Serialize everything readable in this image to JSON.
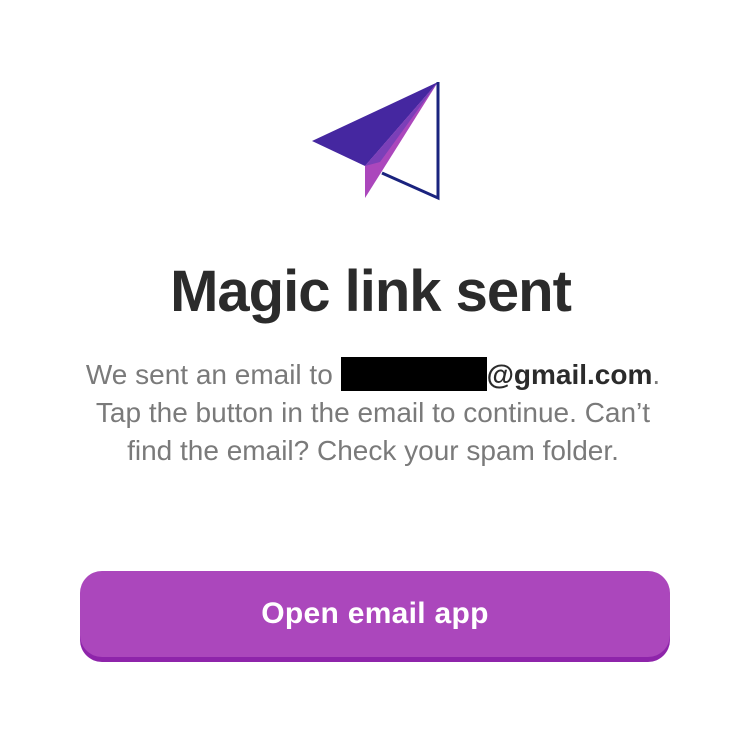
{
  "icon": "paper-plane-icon",
  "colors": {
    "plane_dark": "#4527a0",
    "plane_mid": "#5e35b1",
    "plane_light": "#ab47bc",
    "plane_outline": "#1a237e",
    "title_text": "#2b2b2b",
    "body_text": "#7a7a7a",
    "button_bg": "#ab47bc",
    "button_shadow": "#8e24aa"
  },
  "title": "Magic link sent",
  "message": {
    "prefix": "We sent an email to ",
    "email_domain": "@gmail.com",
    "suffix": ". Tap the button in the email to continue. Can’t find the email? Check your spam folder."
  },
  "button": {
    "label": "Open email app"
  }
}
